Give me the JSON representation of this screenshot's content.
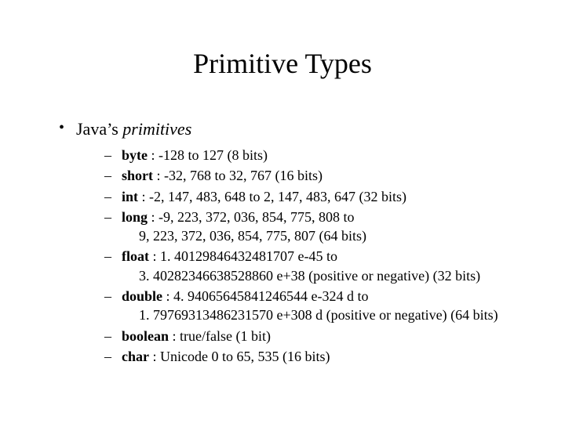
{
  "title": "Primitive Types",
  "bullet": {
    "prefix": "Java’s ",
    "emph": "primitives"
  },
  "items": [
    {
      "name": "byte",
      "rest": " : -128 to 127 (8 bits)"
    },
    {
      "name": "short",
      "rest": " : -32, 768 to 32, 767 (16 bits)"
    },
    {
      "name": "int",
      "rest": " : -2, 147, 483, 648 to 2, 147, 483, 647 (32 bits)"
    },
    {
      "name": "long",
      "rest": " : -9, 223, 372, 036, 854, 775, 808 to",
      "cont": "9, 223, 372, 036, 854, 775, 807 (64 bits)"
    },
    {
      "name": "float",
      "rest": " : 1. 40129846432481707 e-45 to",
      "cont": "3. 40282346638528860 e+38 (positive or negative) (32 bits)"
    },
    {
      "name": "double",
      "rest": " : 4. 94065645841246544 e-324 d to",
      "cont": "1. 79769313486231570 e+308 d (positive or negative) (64 bits)"
    },
    {
      "name": "boolean",
      "rest": " : true/false (1 bit)"
    },
    {
      "name": "char",
      "rest": " : Unicode 0 to 65, 535 (16 bits)"
    }
  ]
}
